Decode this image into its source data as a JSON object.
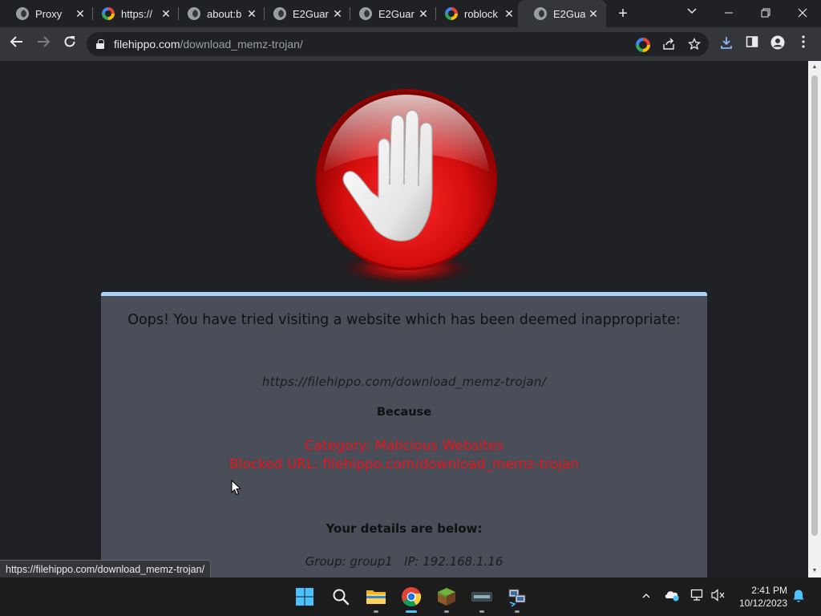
{
  "tabs": [
    {
      "title": "Proxy",
      "icon": "globe-icon"
    },
    {
      "title": "https://",
      "icon": "google-icon"
    },
    {
      "title": "about:b",
      "icon": "globe-icon"
    },
    {
      "title": "E2Guar",
      "icon": "globe-icon"
    },
    {
      "title": "E2Guar",
      "icon": "globe-icon"
    },
    {
      "title": "roblock",
      "icon": "google-icon"
    },
    {
      "title": "E2Guar",
      "icon": "globe-icon",
      "active": true
    }
  ],
  "omnibox": {
    "host": "filehippo.com",
    "path": "/download_memz-trojan/"
  },
  "page": {
    "headline": "Oops! You have tried visiting a website which has been deemed inappropriate:",
    "blocked_url": "https://filehippo.com/download_memz-trojan/",
    "because": "Because",
    "category": "Category: Malicious Websites",
    "blocked_line": "Blocked URL: filehippo.com/download_memz-trojan",
    "details_title": "Your details are below:",
    "details": "Group: group1   IP: 192.168.1.16"
  },
  "status_url": "https://filehippo.com/download_memz-trojan/",
  "clock": {
    "time": "2:41 PM",
    "date": "10/12/2023"
  },
  "colors": {
    "panel_bg": "#4a4e59",
    "panel_top_border": "#a4d4f6",
    "reason_text": "#e8141c",
    "page_bg": "#202124"
  }
}
